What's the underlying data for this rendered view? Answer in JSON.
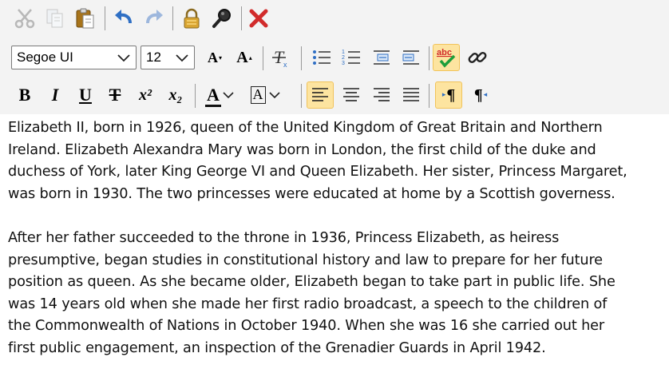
{
  "toolbar": {
    "font_family": "Segoe UI",
    "font_size": "12",
    "spellcheck_label": "abc",
    "bold_label": "B",
    "italic_label": "I",
    "underline_label": "U",
    "strike_label": "T",
    "sup_label": "x²",
    "sub_label": "x₂",
    "grow_label": "A",
    "shrink_label": "A",
    "fontcolor_label": "A",
    "highlight_label": "A",
    "pilcrow_label": "¶"
  },
  "colors": {
    "toolbar_bg": "#f3f3f3",
    "active_bg": "#fde4a0",
    "accent_blue": "#2f6fc4",
    "delete_red": "#d12b2b"
  },
  "document": {
    "paragraphs": [
      {
        "lines": [
          "Elizabeth II, born in 1926, queen of the United Kingdom of Great Britain and Northern",
          "Ireland. Elizabeth Alexandra Mary was born in London, the first child of the duke and",
          "duchess of York, later King George VI and Queen Elizabeth. Her sister, Princess Margaret,",
          "was born in 1930. The two princesses were educated at home by a Scottish governess."
        ]
      },
      {
        "lines": [
          "After her father succeeded to the throne in 1936, Princess Elizabeth, as heiress",
          "presumptive, began studies in constitutional history and law to prepare for her future",
          "position as queen. As she became older, Elizabeth began to take part in public life. She",
          "was 14 years old when she made her first radio broadcast, a speech to the children of",
          "the Commonwealth of Nations in October 1940. When she was 16 she carried out her",
          "first public engagement, an inspection of the Grenadier Guards in April 1942."
        ]
      }
    ]
  }
}
